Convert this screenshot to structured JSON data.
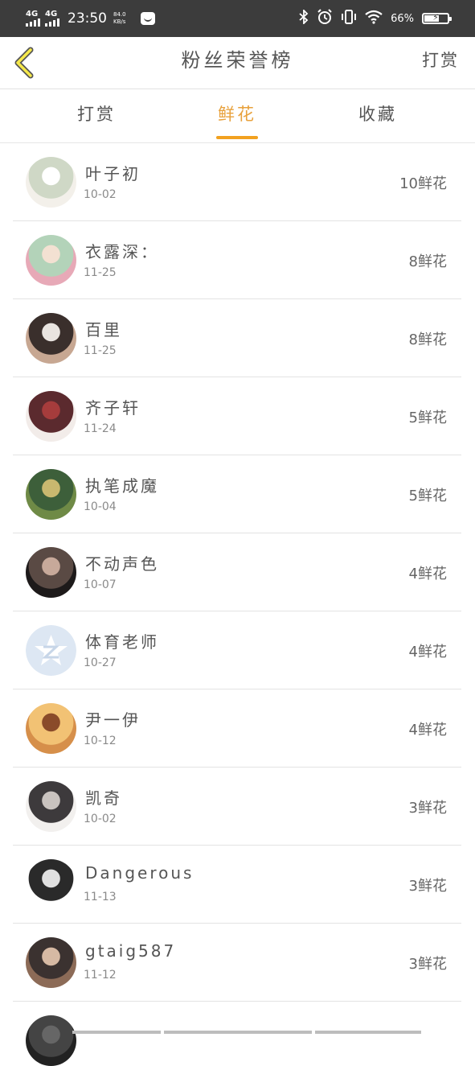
{
  "status_bar": {
    "signal1": "4G",
    "signal2": "4G",
    "time": "23:50",
    "speed_value": "84.0",
    "speed_unit": "KB/s",
    "battery_percent": "66%",
    "battery_level": 0.66
  },
  "header": {
    "title": "粉丝荣誉榜",
    "right_link": "打赏"
  },
  "tabs": [
    {
      "label": "打赏",
      "active": false
    },
    {
      "label": "鲜花",
      "active": true
    },
    {
      "label": "收藏",
      "active": false
    }
  ],
  "rows": [
    {
      "name": "叶子初",
      "date": "10-02",
      "amount": "10鲜花",
      "avatar_colors": [
        "#f3f0ea",
        "#cfd8c6",
        "#ffffff"
      ]
    },
    {
      "name": "衣露深：",
      "date": "11-25",
      "amount": "8鲜花",
      "avatar_colors": [
        "#e7a9b7",
        "#b3d3b9",
        "#f3e1d2"
      ]
    },
    {
      "name": "百里",
      "date": "11-25",
      "amount": "8鲜花",
      "avatar_colors": [
        "#c7a792",
        "#3a2f2c",
        "#e9e4e0"
      ]
    },
    {
      "name": "齐子轩",
      "date": "11-24",
      "amount": "5鲜花",
      "avatar_colors": [
        "#f2ece9",
        "#5b2a2e",
        "#a63c3c"
      ]
    },
    {
      "name": "执笔成魔",
      "date": "10-04",
      "amount": "5鲜花",
      "avatar_colors": [
        "#6f8a46",
        "#3d5f3a",
        "#c9b86f"
      ]
    },
    {
      "name": "不动声色",
      "date": "10-07",
      "amount": "4鲜花",
      "avatar_colors": [
        "#1d1a1a",
        "#5a4a44",
        "#c7a99a"
      ]
    },
    {
      "name": "体育老师",
      "date": "10-27",
      "amount": "4鲜花",
      "avatar_colors": [
        "#dfe8f3",
        "#c9d8ea",
        "#ffffff"
      ]
    },
    {
      "name": "尹一伊",
      "date": "10-12",
      "amount": "4鲜花",
      "avatar_colors": [
        "#d68f4a",
        "#f2c274",
        "#8a4b2a"
      ]
    },
    {
      "name": "凯奇",
      "date": "10-02",
      "amount": "3鲜花",
      "avatar_colors": [
        "#f2f0ee",
        "#3d3a3c",
        "#c9c3bf"
      ]
    },
    {
      "name": "Dangerous",
      "date": "11-13",
      "amount": "3鲜花",
      "avatar_colors": [
        "#ffffff",
        "#2a2a2a",
        "#e0e0e0"
      ]
    },
    {
      "name": "gtaig587",
      "date": "11-12",
      "amount": "3鲜花",
      "avatar_colors": [
        "#8c6b57",
        "#3b3230",
        "#d6b9a3"
      ]
    },
    {
      "name": "",
      "date": "",
      "amount": "",
      "avatar_colors": [
        "#222222",
        "#444444",
        "#666666"
      ]
    }
  ]
}
